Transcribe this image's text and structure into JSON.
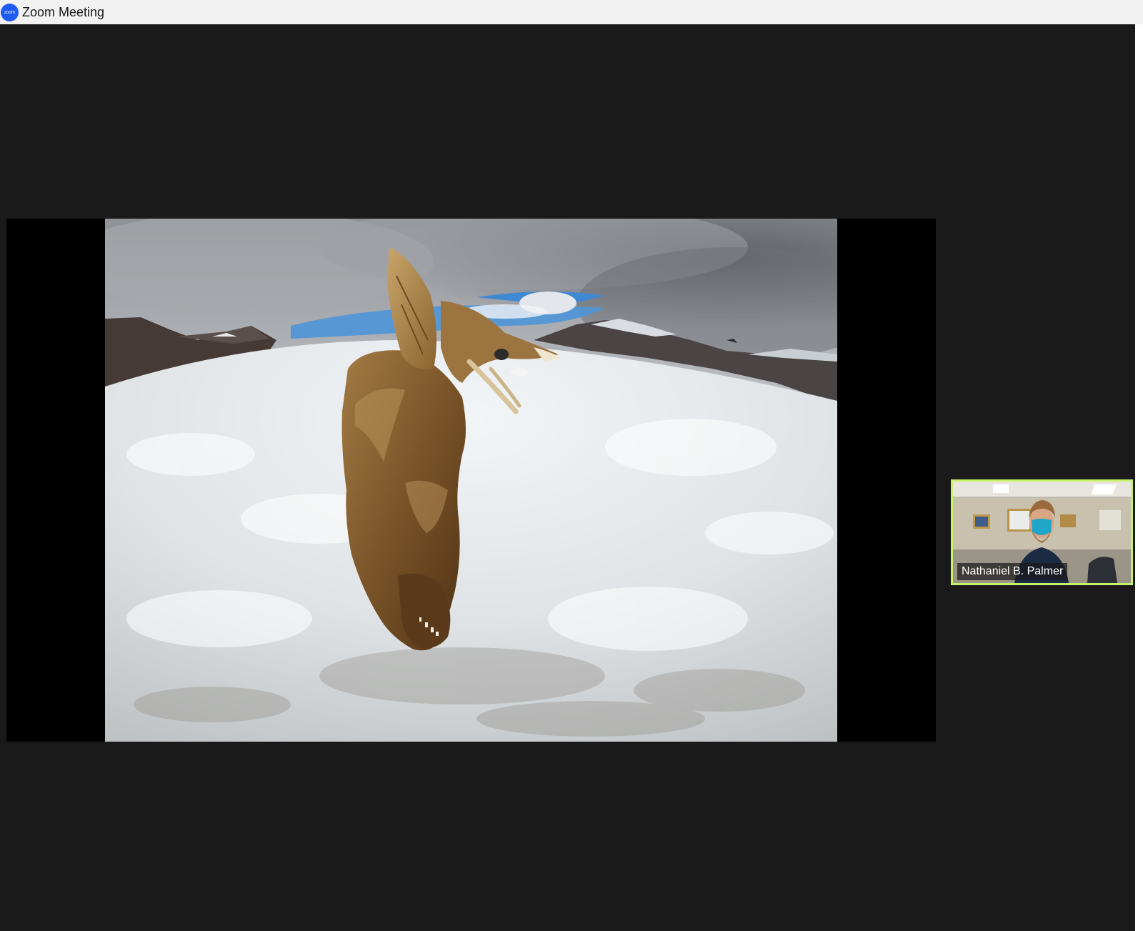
{
  "window": {
    "title": "Zoom Meeting",
    "app_icon_text": "zoom",
    "app_icon": "zoom-logo-icon",
    "accent_color": "#1e5bf0"
  },
  "meeting": {
    "background_color": "#1a1a1a",
    "shared_content": {
      "kind": "photo"
    },
    "participants": [
      {
        "name": "Nathaniel B. Palmer",
        "active_speaker": true,
        "highlight_color": "#c7f26a"
      }
    ]
  }
}
